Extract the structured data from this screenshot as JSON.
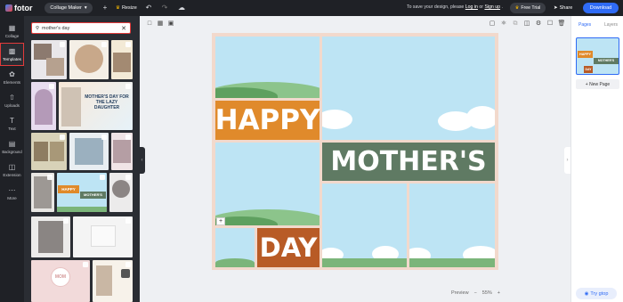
{
  "topbar": {
    "logo": "fotor",
    "mode_label": "Collage Maker",
    "resize_label": "Resize",
    "save_prefix": "To save your design, please",
    "login": "Log in",
    "or": "or",
    "signup": "Sign up",
    "trial_label": "Free Trial",
    "share_label": "Share",
    "download_label": "Download"
  },
  "rail": [
    {
      "label": "Collage",
      "icon": "collage-icon"
    },
    {
      "label": "Templates",
      "icon": "templates-icon"
    },
    {
      "label": "Elements",
      "icon": "elements-icon"
    },
    {
      "label": "Uploads",
      "icon": "uploads-icon"
    },
    {
      "label": "Text",
      "icon": "text-icon"
    },
    {
      "label": "Background",
      "icon": "background-icon"
    },
    {
      "label": "Extension",
      "icon": "extension-icon"
    },
    {
      "label": "More",
      "icon": "more-icon"
    }
  ],
  "search": {
    "value": "mother's day"
  },
  "thumbs": {
    "t4": "MOTHER'S DAY FOR THE LAZY DAUGHTER",
    "t9a": "HAPPY",
    "t9b": "MOTHER'S",
    "t12": "MOM"
  },
  "canvas": {
    "happy": "HAPPY",
    "mothers": "MOTHER'S",
    "day": "DAY",
    "colors": {
      "orange": "#e08a2b",
      "green": "#5f7a63",
      "rust": "#b85b26",
      "sky": "#bde4f4",
      "frame": "#f2d9cc"
    }
  },
  "zoom": {
    "preview": "Preview",
    "value": "55%"
  },
  "rpanel": {
    "tab_pages": "Pages",
    "tab_layers": "Layers",
    "new_page": "New Page",
    "help": "Try gtop"
  }
}
